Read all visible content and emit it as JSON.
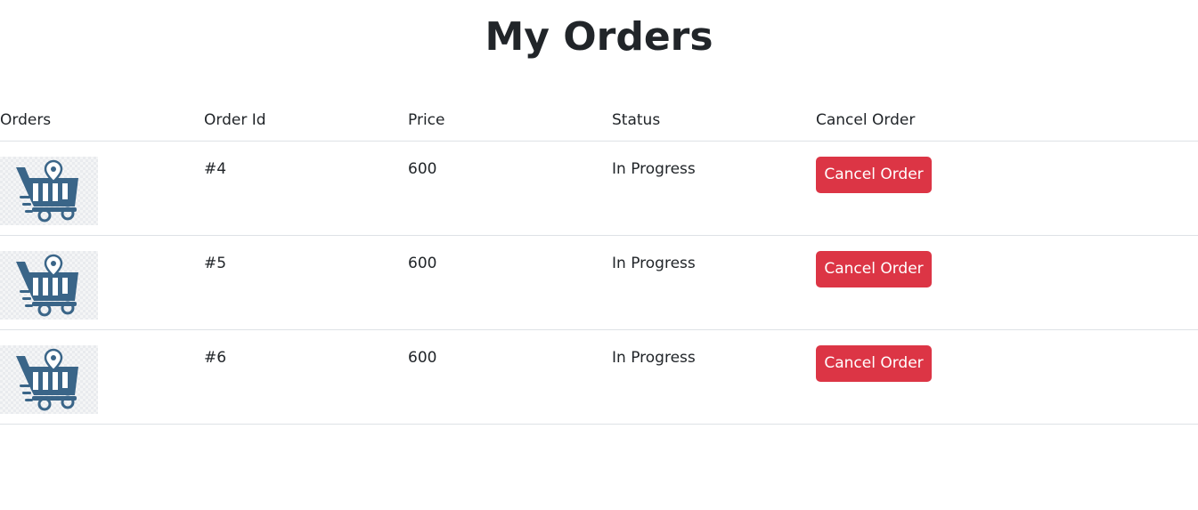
{
  "page": {
    "title": "My Orders"
  },
  "table": {
    "headers": [
      "Orders",
      "Order Id",
      "Price",
      "Status",
      "Cancel Order"
    ],
    "rows": [
      {
        "thumbnail_icon": "shopping-cart-location-icon",
        "order_id": "#4",
        "price": "600",
        "status": "In Progress",
        "action_label": "Cancel Order"
      },
      {
        "thumbnail_icon": "shopping-cart-location-icon",
        "order_id": "#5",
        "price": "600",
        "status": "In Progress",
        "action_label": "Cancel Order"
      },
      {
        "thumbnail_icon": "shopping-cart-location-icon",
        "order_id": "#6",
        "price": "600",
        "status": "In Progress",
        "action_label": "Cancel Order"
      }
    ]
  },
  "colors": {
    "danger": "#dc3545",
    "icon": "#3a6588",
    "text": "#212529",
    "border": "#dee2e6"
  }
}
